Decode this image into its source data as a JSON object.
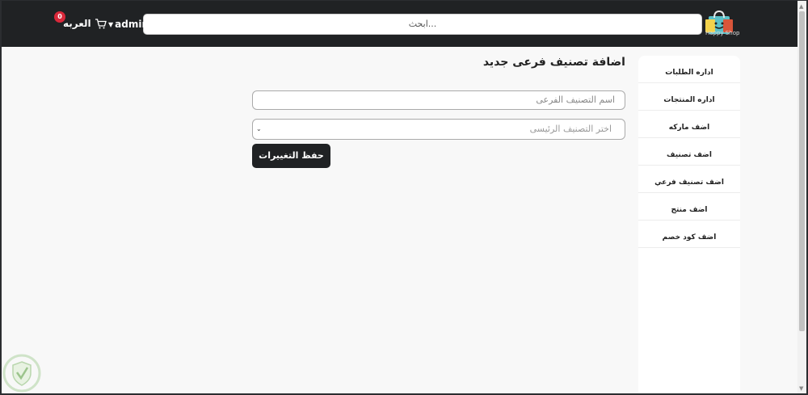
{
  "header": {
    "logo_text": "Happy Shop",
    "search_placeholder": "ابحث...",
    "user_name": "admin",
    "cart_label": "العربه",
    "cart_count": "0"
  },
  "sidebar": {
    "items": [
      {
        "label": "اداره الطلبات"
      },
      {
        "label": "اداره المنتجات"
      },
      {
        "label": "اضف ماركه"
      },
      {
        "label": "اضف تصنيف"
      },
      {
        "label": "اضف تصنيف فرعي"
      },
      {
        "label": "اضف منتج"
      },
      {
        "label": "اضف كود خصم"
      }
    ]
  },
  "main": {
    "title": "اضافة تصنيف فرعى جديد",
    "subcategory_input_placeholder": "اسم التصنيف الفرعى",
    "main_category_select_placeholder": "اختر التصنيف الرئيسى",
    "save_label": "حفظ التغييرات"
  },
  "colors": {
    "navbar": "#202224",
    "page_background": "#f8f8f8",
    "badge": "#d9283a",
    "button": "#202224"
  }
}
